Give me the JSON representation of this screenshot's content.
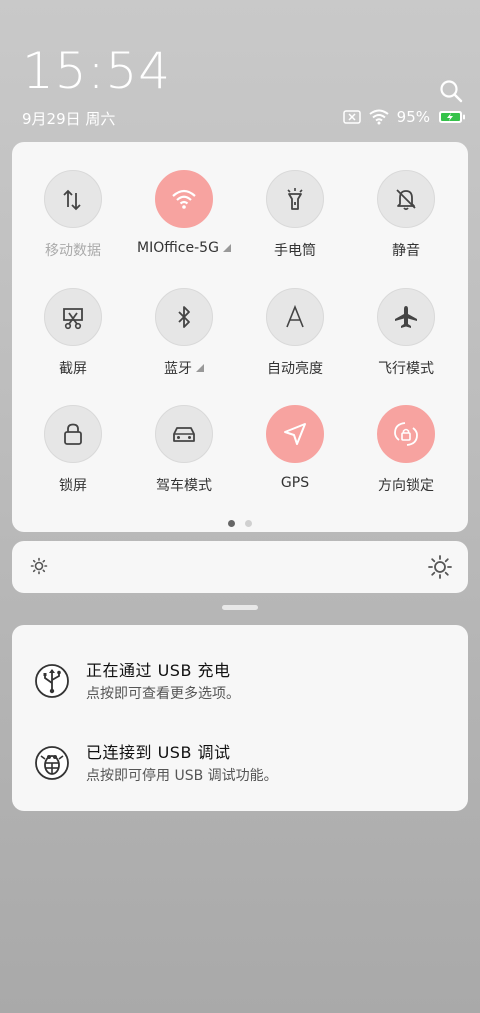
{
  "lockscreen": {
    "time": "15:54",
    "date": "9月29日 周六"
  },
  "status_bar": {
    "battery_percent": "95%",
    "icons": [
      "sim-card-x-icon",
      "wifi-icon",
      "battery-charging-icon"
    ]
  },
  "toggles": [
    {
      "label": "移动数据",
      "icon": "mobile-data-icon",
      "active": false,
      "dim": true,
      "has_more": false
    },
    {
      "label": "MIOffice-5G",
      "icon": "wifi-icon",
      "active": true,
      "dim": false,
      "has_more": true
    },
    {
      "label": "手电筒",
      "icon": "flashlight-icon",
      "active": false,
      "dim": false,
      "has_more": false
    },
    {
      "label": "静音",
      "icon": "bell-off-icon",
      "active": false,
      "dim": false,
      "has_more": false
    },
    {
      "label": "截屏",
      "icon": "screenshot-icon",
      "active": false,
      "dim": false,
      "has_more": false
    },
    {
      "label": "蓝牙",
      "icon": "bluetooth-icon",
      "active": false,
      "dim": false,
      "has_more": true
    },
    {
      "label": "自动亮度",
      "icon": "auto-brightness-icon",
      "active": false,
      "dim": false,
      "has_more": false
    },
    {
      "label": "飞行模式",
      "icon": "airplane-icon",
      "active": false,
      "dim": false,
      "has_more": false
    },
    {
      "label": "锁屏",
      "icon": "lock-icon",
      "active": false,
      "dim": false,
      "has_more": false
    },
    {
      "label": "驾车模式",
      "icon": "car-icon",
      "active": false,
      "dim": false,
      "has_more": false
    },
    {
      "label": "GPS",
      "icon": "location-arrow-icon",
      "active": true,
      "dim": false,
      "has_more": false
    },
    {
      "label": "方向锁定",
      "icon": "rotation-lock-icon",
      "active": true,
      "dim": false,
      "has_more": false
    }
  ],
  "pager": {
    "pages": 2,
    "current": 1
  },
  "brightness": {
    "icons": [
      "sun-low-icon",
      "sun-high-icon"
    ]
  },
  "notifications": [
    {
      "title": "正在通过 USB 充电",
      "subtitle": "点按即可查看更多选项。",
      "icon": "usb-icon"
    },
    {
      "title": "已连接到 USB 调试",
      "subtitle": "点按即可停用 USB 调试功能。",
      "icon": "bug-icon"
    }
  ],
  "colors": {
    "active": "#f7a3a0",
    "tile": "#e6e6e6",
    "panel": "#f7f7f7"
  }
}
